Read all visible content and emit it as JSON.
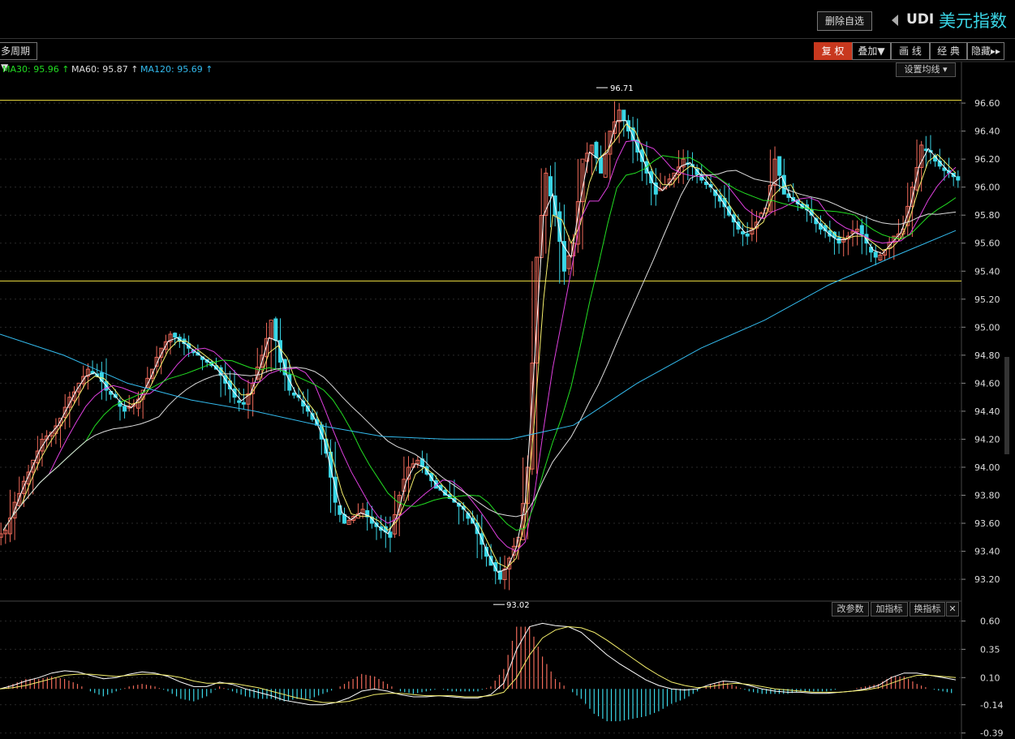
{
  "header": {
    "remove_watchlist": "删除自选",
    "symbol_code": "UDI",
    "symbol_name": "美元指数"
  },
  "toolbar": {
    "period": "多周期▼",
    "buttons": [
      "复 权",
      "叠加▼",
      "画 线",
      "经 典",
      "隐藏▸▸"
    ]
  },
  "ma_legend": [
    {
      "label": "MA30: 95.96 ↑",
      "color": "#22dd22"
    },
    {
      "label": "MA60: 95.87 ↑",
      "color": "#dddddd"
    },
    {
      "label": "MA120: 95.69 ↑",
      "color": "#33bbee"
    }
  ],
  "set_ma": "设置均线 ▾",
  "indicator_buttons": [
    "改参数",
    "加指标",
    "换指标",
    "✕"
  ],
  "colors": {
    "up": "#f06a5a",
    "down": "#3ad6e6",
    "ma5": "#ffffff",
    "ma10": "#f5ef6c",
    "ma20": "#e040e0",
    "ma30": "#22dd22",
    "ma60": "#dddddd",
    "ma120": "#33bbee",
    "hline": "#f0e040"
  },
  "chart_data": {
    "type": "candlestick",
    "price_axis": {
      "ticks": [
        96.6,
        96.4,
        96.2,
        96.0,
        95.8,
        95.6,
        95.4,
        95.2,
        95.0,
        94.8,
        94.6,
        94.4,
        94.2,
        94.0,
        93.8,
        93.6,
        93.4,
        93.2
      ],
      "labels": [
        "96.60",
        "96.40",
        "96.20",
        "96.00",
        "95.80",
        "95.60",
        "95.40",
        "95.20",
        "95.00",
        "94.80",
        "94.60",
        "94.40",
        "94.20",
        "94.00",
        "93.80",
        "93.60",
        "93.40",
        "93.20"
      ],
      "range": [
        93.05,
        96.78
      ]
    },
    "high_annotation": {
      "value": 96.71,
      "label": "96.71"
    },
    "low_annotation": {
      "value": 93.02,
      "label": "93.02"
    },
    "horizontal_lines": [
      96.62,
      95.33
    ],
    "close_path": [
      93.55,
      93.75,
      93.9,
      94.05,
      94.2,
      94.25,
      94.35,
      94.5,
      94.6,
      94.7,
      94.65,
      94.55,
      94.5,
      94.4,
      94.45,
      94.55,
      94.7,
      94.85,
      94.95,
      94.9,
      94.85,
      94.8,
      94.75,
      94.7,
      94.6,
      94.5,
      94.45,
      94.6,
      94.8,
      95.05,
      94.75,
      94.55,
      94.5,
      94.4,
      94.3,
      94.1,
      93.75,
      93.6,
      93.65,
      93.7,
      93.6,
      93.55,
      93.5,
      93.8,
      94.0,
      94.05,
      93.95,
      93.85,
      93.8,
      93.75,
      93.7,
      93.6,
      93.45,
      93.3,
      93.2,
      93.35,
      93.5,
      94.0,
      95.5,
      96.1,
      95.8,
      95.4,
      95.6,
      96.2,
      96.3,
      96.1,
      96.4,
      96.55,
      96.4,
      96.25,
      96.1,
      95.95,
      96.0,
      96.1,
      96.2,
      96.15,
      96.05,
      96.0,
      95.9,
      95.8,
      95.7,
      95.65,
      95.75,
      95.85,
      96.2,
      95.95,
      95.9,
      95.85,
      95.8,
      95.7,
      95.65,
      95.6,
      95.65,
      95.7,
      95.6,
      95.5,
      95.55,
      95.65,
      95.7,
      96.0,
      96.3,
      96.25,
      96.15,
      96.1,
      96.05
    ],
    "macd": {
      "axis": {
        "ticks": [
          0.6,
          0.35,
          0.1,
          -0.14,
          -0.39
        ],
        "labels": [
          "0.60",
          "0.35",
          "0.10",
          "-0.14",
          "-0.39"
        ],
        "range": [
          -0.4,
          0.64
        ]
      },
      "dif": [
        0.0,
        0.03,
        0.07,
        0.1,
        0.14,
        0.16,
        0.15,
        0.12,
        0.09,
        0.1,
        0.13,
        0.15,
        0.14,
        0.11,
        0.06,
        0.02,
        0.02,
        0.06,
        0.04,
        0.0,
        -0.03,
        -0.06,
        -0.1,
        -0.12,
        -0.14,
        -0.14,
        -0.12,
        -0.08,
        -0.02,
        0.0,
        -0.02,
        -0.05,
        -0.07,
        -0.07,
        -0.06,
        -0.07,
        -0.08,
        -0.08,
        -0.05,
        0.05,
        0.35,
        0.55,
        0.58,
        0.56,
        0.55,
        0.5,
        0.4,
        0.3,
        0.22,
        0.15,
        0.08,
        0.03,
        0.0,
        -0.01,
        0.0,
        0.04,
        0.07,
        0.06,
        0.03,
        0.0,
        -0.02,
        -0.03,
        -0.03,
        -0.04,
        -0.04,
        -0.03,
        -0.02,
        0.0,
        0.03,
        0.1,
        0.14,
        0.14,
        0.12,
        0.1,
        0.08
      ],
      "dea": [
        0.0,
        0.01,
        0.03,
        0.06,
        0.09,
        0.12,
        0.13,
        0.13,
        0.12,
        0.11,
        0.12,
        0.13,
        0.13,
        0.12,
        0.1,
        0.07,
        0.05,
        0.05,
        0.05,
        0.03,
        0.01,
        -0.02,
        -0.05,
        -0.08,
        -0.1,
        -0.12,
        -0.12,
        -0.11,
        -0.08,
        -0.05,
        -0.04,
        -0.04,
        -0.05,
        -0.06,
        -0.06,
        -0.06,
        -0.07,
        -0.07,
        -0.06,
        -0.03,
        0.1,
        0.3,
        0.45,
        0.52,
        0.55,
        0.54,
        0.5,
        0.43,
        0.35,
        0.27,
        0.19,
        0.12,
        0.06,
        0.03,
        0.01,
        0.02,
        0.04,
        0.05,
        0.04,
        0.02,
        0.0,
        -0.01,
        -0.02,
        -0.03,
        -0.03,
        -0.03,
        -0.02,
        -0.01,
        0.01,
        0.05,
        0.09,
        0.12,
        0.12,
        0.11,
        0.1
      ]
    }
  }
}
